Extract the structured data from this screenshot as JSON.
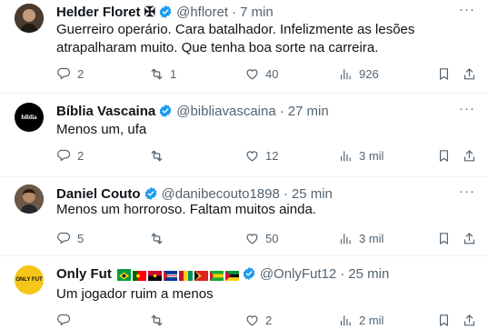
{
  "tweets": [
    {
      "name": "Helder Floret",
      "name_suffix": "✠",
      "handle": "@hfloret",
      "time": "7 min",
      "text": "Guerreiro operário. Cara batalhador. Infelizmente as lesões atrapalharam muito. Que tenha boa sorte na carreira.",
      "replies": "2",
      "reposts": "1",
      "likes": "40",
      "views": "926"
    },
    {
      "name": "Bíblia Vascaina",
      "handle": "@bibliavascaina",
      "time": "27 min",
      "avatar_text": "bíblia",
      "text": "Menos um, ufa",
      "replies": "2",
      "reposts": "",
      "likes": "12",
      "views": "3 mil"
    },
    {
      "name": "Daniel Couto",
      "handle": "@danibecouto1898",
      "time": "25 min",
      "text": "Menos um horroroso. Faltam muitos ainda.",
      "replies": "5",
      "reposts": "",
      "likes": "50",
      "views": "3 mil"
    },
    {
      "name": "Only Fut",
      "handle": "@OnlyFut12",
      "time": "25 min",
      "avatar_text": "ONLY FUT",
      "text": "Um jogador ruim a menos",
      "replies": "",
      "reposts": "",
      "likes": "2",
      "views": "2 mil"
    }
  ],
  "colors": {
    "verified": "#1d9bf0",
    "secondary_text": "#536471",
    "separator": "#eff3f4",
    "only_fut_gold": "#f5c518"
  },
  "icons": [
    "reply-icon",
    "repost-icon",
    "like-icon",
    "views-icon",
    "bookmark-icon",
    "share-icon",
    "more-icon",
    "verified-badge-icon"
  ]
}
